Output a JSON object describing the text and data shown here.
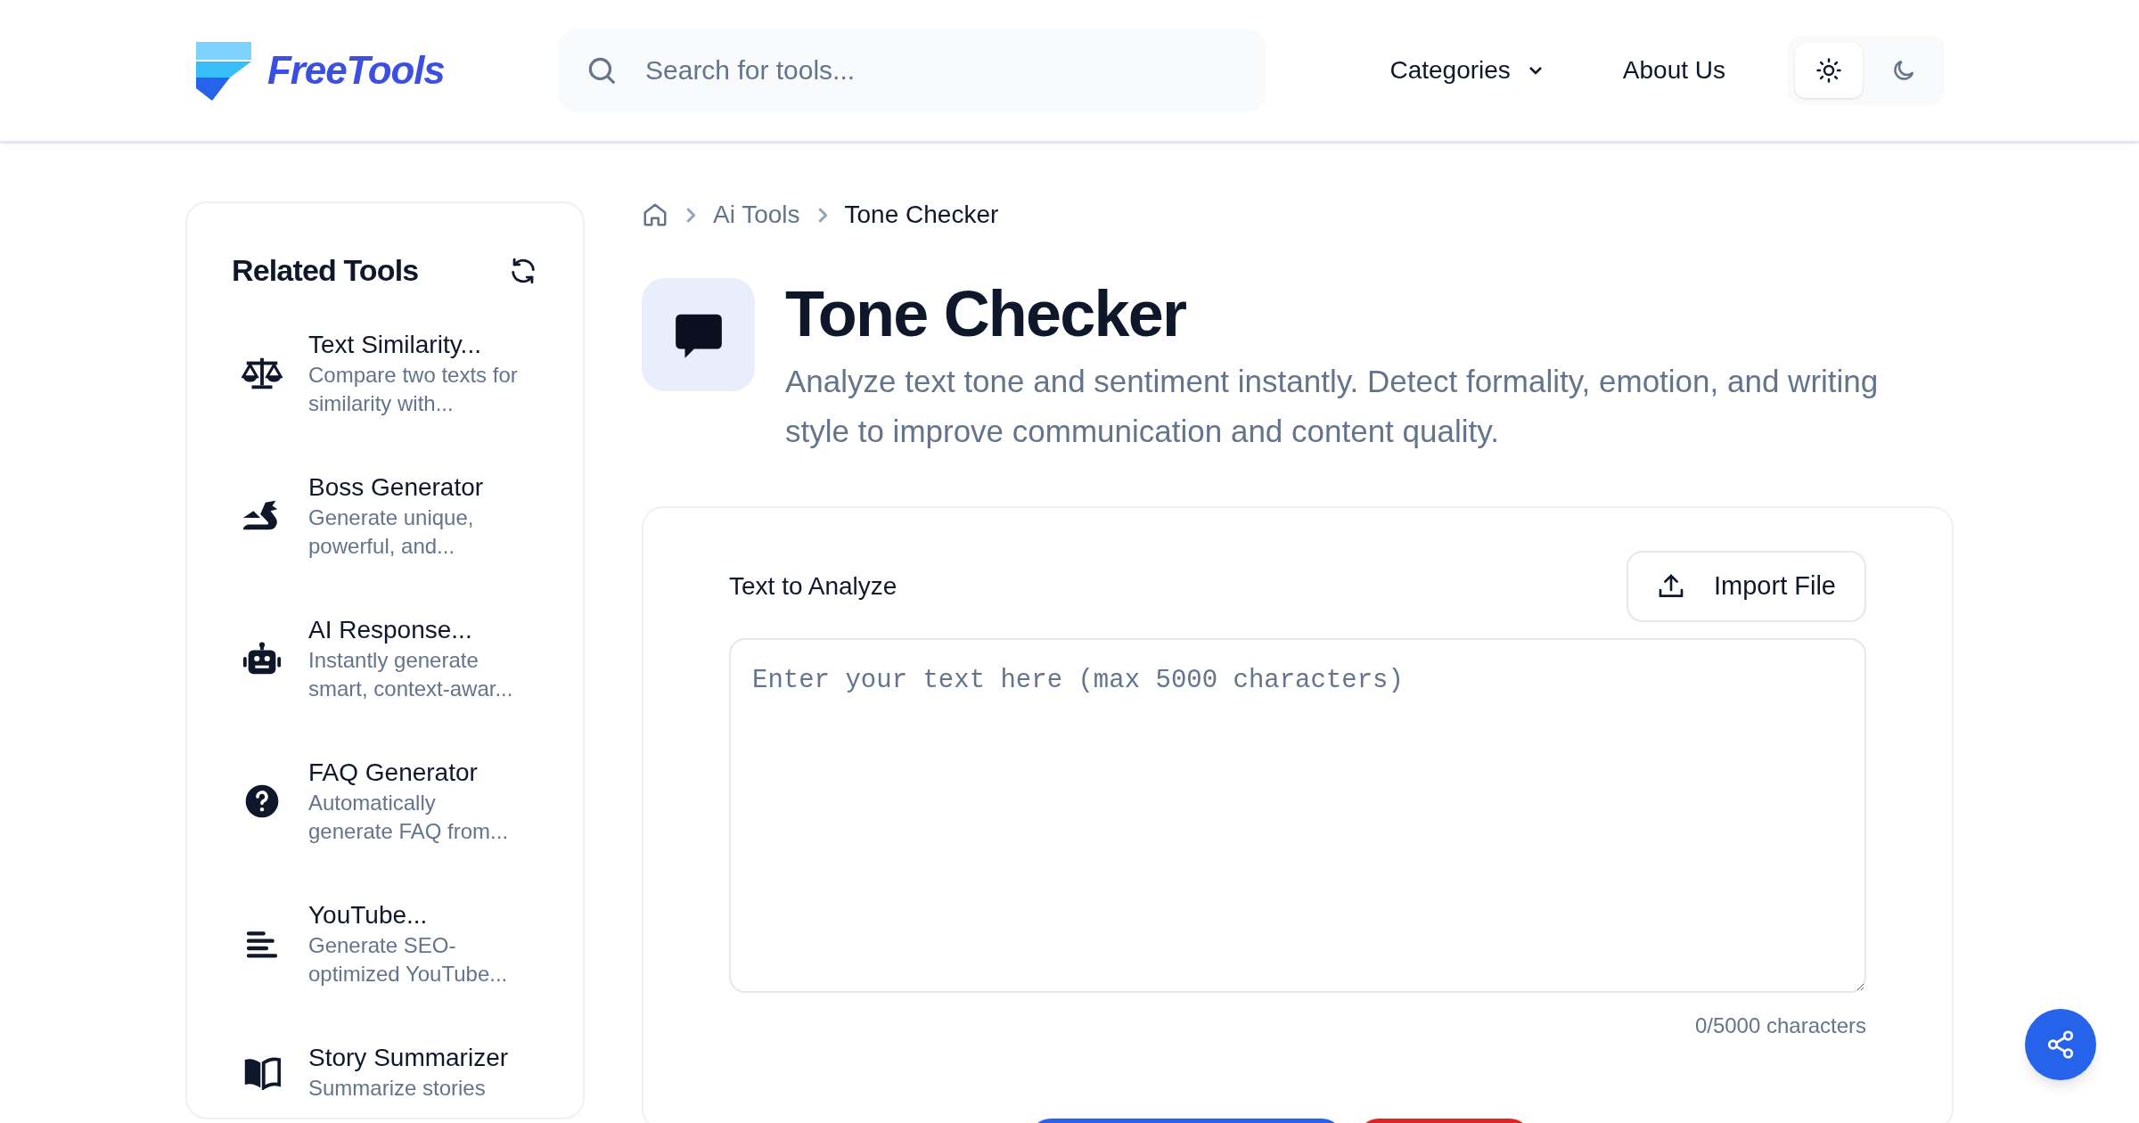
{
  "header": {
    "logo": "FreeTools",
    "search": {
      "placeholder": "Search for tools..."
    },
    "nav": [
      {
        "label": "Categories",
        "kind": "dropdown"
      },
      {
        "label": "About Us",
        "kind": "link"
      }
    ],
    "theme": [
      {
        "kind": "light",
        "selected": true
      },
      {
        "kind": "dark",
        "selected": false
      }
    ]
  },
  "sidebar": {
    "title": "Related Tools",
    "items": [
      {
        "title": "Text Similarity...",
        "description": "Compare two texts for similarity with..."
      },
      {
        "title": "Boss Generator",
        "description": "Generate unique, powerful, and..."
      },
      {
        "title": "AI Response...",
        "description": "Instantly generate smart, context-awar..."
      },
      {
        "title": "FAQ Generator",
        "description": "Automatically generate FAQ from..."
      },
      {
        "title": "YouTube...",
        "description": "Generate SEO-optimized YouTube..."
      },
      {
        "title": "Story Summarizer",
        "description": "Summarize stories"
      }
    ]
  },
  "breadcrumb": [
    "Ai Tools",
    "Tone Checker"
  ],
  "tool": {
    "title": "Tone Checker",
    "description": "Analyze text tone and sentiment instantly. Detect formality, emotion, and writing style to improve communication and content quality."
  },
  "form": {
    "label": "Text to Analyze",
    "import_button": "Import File",
    "textarea": {
      "placeholder": "Enter your text here (max 5000 characters)"
    },
    "counter": "0/5000 characters",
    "buttons": [
      {
        "color": "#2563eb"
      },
      {
        "color": "#dc2626"
      }
    ]
  }
}
